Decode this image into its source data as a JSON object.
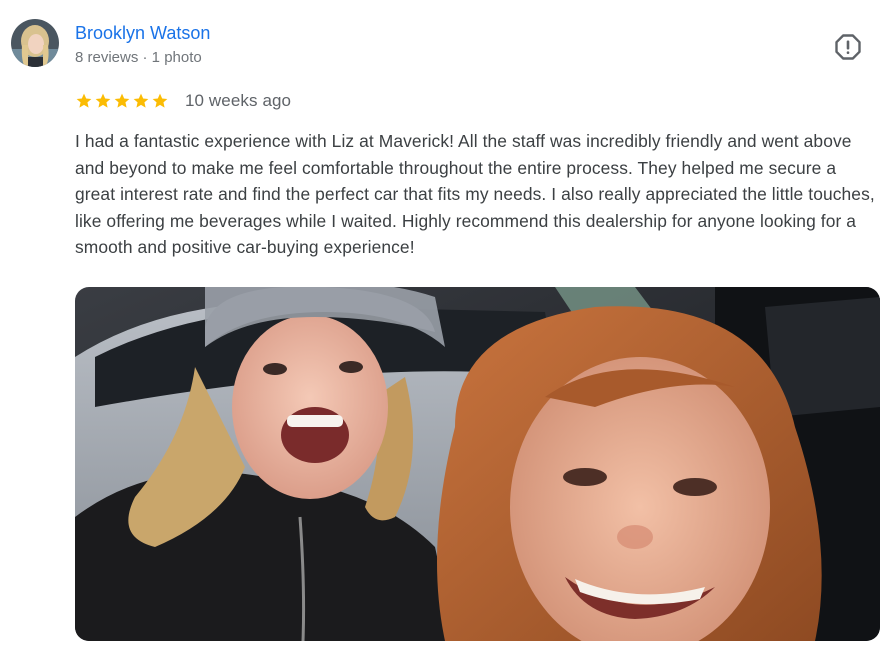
{
  "review": {
    "author": {
      "name": "Brooklyn Watson",
      "meta": "8 reviews · 1 photo",
      "avatar_icon": "profile-photo"
    },
    "rating": 5,
    "rating_max": 5,
    "date": "10 weeks ago",
    "text": "I had a fantastic experience with Liz at Maverick! All the staff was incredibly friendly and went above and beyond to make me feel comfortable throughout the entire process. They helped me secure a great interest rate and find the perfect car that fits my needs. I also really appreciated the little touches, like offering me beverages while I waited. Highly recommend this dealership for anyone looking for a smooth and positive car-buying experience!",
    "report_icon": "report-flag-icon",
    "photo_count": 1
  },
  "colors": {
    "name_link": "#1a73e8",
    "meta_text": "#70757a",
    "star": "#fbbc04",
    "body_text": "#3c4043",
    "icon": "#5f6368"
  }
}
